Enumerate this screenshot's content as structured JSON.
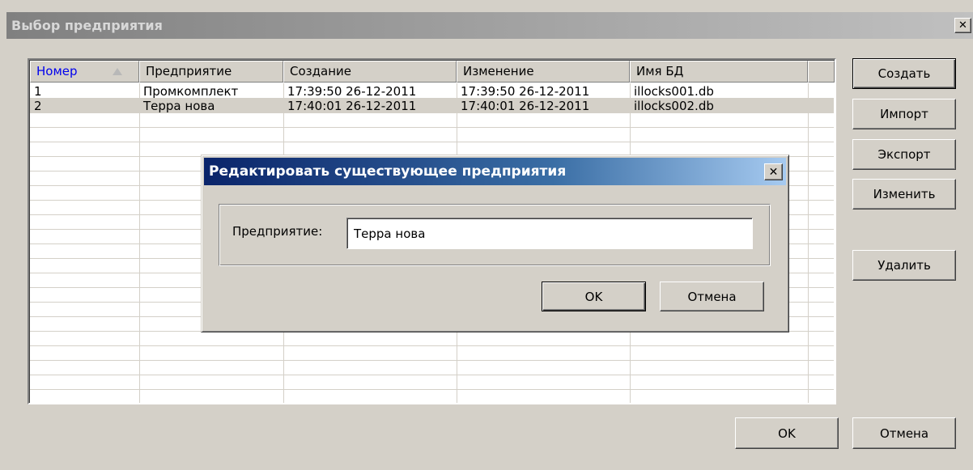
{
  "window": {
    "title": "Выбор предприятия",
    "close_glyph": "✕"
  },
  "table": {
    "columns": [
      "Номер",
      "Предприятие",
      "Создание",
      "Изменение",
      "Имя БД"
    ],
    "sort_column": "Номер",
    "sort_direction": "ascending",
    "rows": [
      [
        "1",
        "Промкомплект",
        "17:39:50 26-12-2011",
        "17:39:50 26-12-2011",
        "illocks001.db"
      ],
      [
        "2",
        "Терра нова",
        "17:40:01 26-12-2011",
        "17:40:01 26-12-2011",
        "illocks002.db"
      ]
    ],
    "selected_row": 1
  },
  "side_buttons": {
    "create": "Создать",
    "import": "Импорт",
    "export": "Экспорт",
    "edit": "Изменить",
    "delete": "Удалить"
  },
  "footer": {
    "ok": "OK",
    "cancel": "Отмена"
  },
  "dialog": {
    "title": "Редактировать существующее предприятия",
    "field_label": "Предприятие:",
    "field_value": "Терра нова",
    "ok": "OK",
    "cancel": "Отмена"
  },
  "colors": {
    "dialog_title_start": "#0a246a",
    "dialog_title_end": "#a6caf0",
    "sorted_header_text": "#0000ee",
    "face": "#d4d0c8"
  }
}
